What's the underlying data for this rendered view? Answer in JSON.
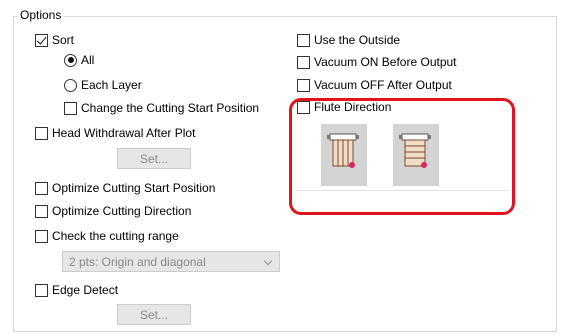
{
  "group_title": "Options",
  "left": {
    "sort": {
      "label": "Sort",
      "checked": true
    },
    "all": {
      "label": "All",
      "selected": true
    },
    "each_layer": {
      "label": "Each Layer",
      "selected": false
    },
    "change_start": {
      "label": "Change the Cutting Start Position",
      "checked": false
    },
    "head_withdrawal": {
      "label": "Head Withdrawal After Plot",
      "checked": false
    },
    "set_button_1": "Set...",
    "optimize_start": {
      "label": "Optimize Cutting Start Position",
      "checked": false
    },
    "optimize_direction": {
      "label": "Optimize Cutting Direction",
      "checked": false
    },
    "check_range": {
      "label": "Check the cutting range",
      "checked": false
    },
    "range_select": "2 pts: Origin and diagonal",
    "edge_detect": {
      "label": "Edge Detect",
      "checked": false
    },
    "set_button_2": "Set..."
  },
  "right": {
    "use_outside": {
      "label": "Use the Outside",
      "checked": false
    },
    "vacuum_on": {
      "label": "Vacuum ON Before Output",
      "checked": false
    },
    "vacuum_off": {
      "label": "Vacuum OFF After Output",
      "checked": false
    },
    "flute_direction": {
      "label": "Flute Direction",
      "checked": false
    }
  },
  "colors": {
    "highlight": "#e0141e",
    "disabled_bg": "#e6e6e6",
    "disabled_text": "#8a8a8a",
    "flute_accent": "#e0245e",
    "flute_fill": "#f1dcc8"
  }
}
